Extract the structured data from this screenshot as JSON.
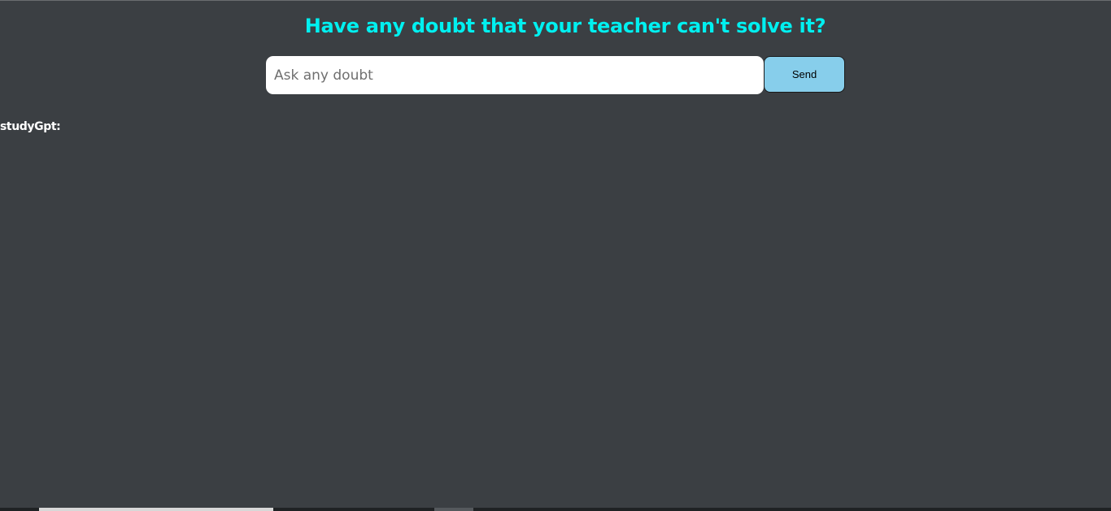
{
  "header": {
    "title": "Have any doubt that your teacher can't solve it?"
  },
  "query": {
    "placeholder": "Ask any doubt",
    "value": "",
    "send_label": "Send"
  },
  "response": {
    "bot_label": "studyGpt:",
    "text": ""
  },
  "colors": {
    "background": "#3b3f43",
    "title": "#00f0f0",
    "send_button": "#87ceeb"
  }
}
